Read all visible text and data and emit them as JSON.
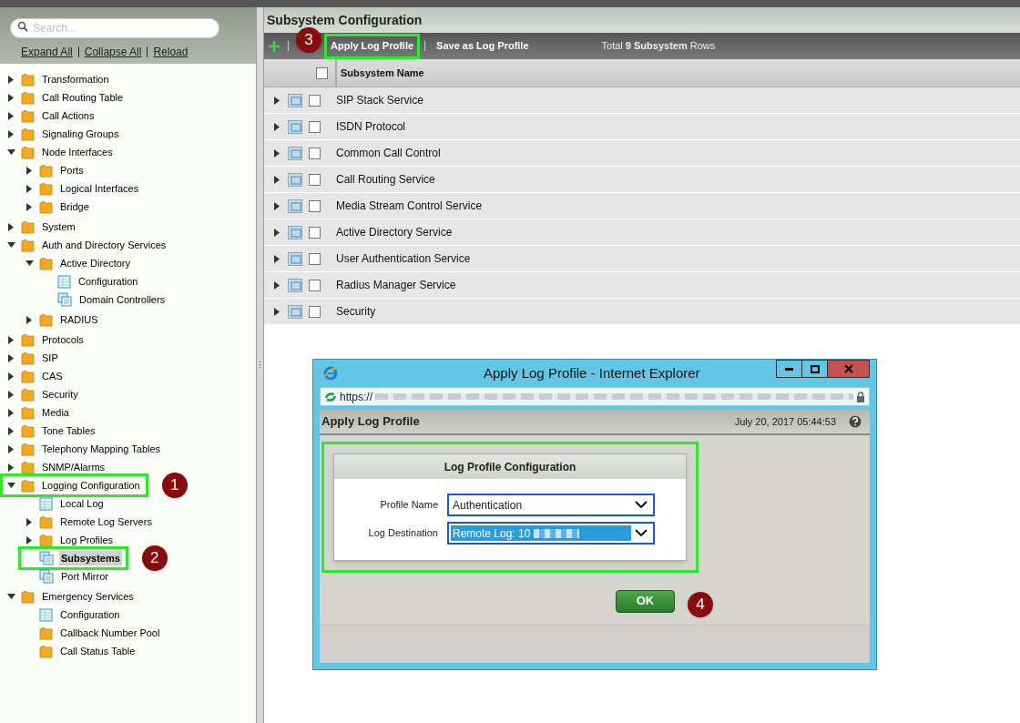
{
  "sidebar": {
    "search": {
      "placeholder": "Search..."
    },
    "links": [
      "Expand All",
      "Collapse All",
      "Reload"
    ],
    "tree": [
      {
        "label": "Transformation",
        "kind": "folder",
        "expanded": false,
        "selected": false
      },
      {
        "label": "Call Routing Table",
        "kind": "folder",
        "expanded": false,
        "selected": false
      },
      {
        "label": "Call Actions",
        "kind": "folder",
        "expanded": false,
        "selected": false
      },
      {
        "label": "Signaling Groups",
        "kind": "folder",
        "expanded": false,
        "selected": false
      },
      {
        "label": "Node Interfaces",
        "kind": "folder",
        "expanded": true,
        "selected": false,
        "children": [
          {
            "label": "Ports",
            "kind": "folder",
            "expanded": false,
            "selected": false
          },
          {
            "label": "Logical Interfaces",
            "kind": "folder",
            "expanded": false,
            "selected": false
          },
          {
            "label": "Bridge",
            "kind": "folder",
            "expanded": false,
            "selected": false
          }
        ]
      },
      {
        "label": "System",
        "kind": "folder",
        "expanded": false,
        "selected": false
      },
      {
        "label": "Auth and Directory Services",
        "kind": "folder",
        "expanded": true,
        "selected": false,
        "children": [
          {
            "label": "Active Directory",
            "kind": "folder",
            "expanded": true,
            "selected": false,
            "children": [
              {
                "label": "Configuration",
                "kind": "table",
                "selected": false
              },
              {
                "label": "Domain Controllers",
                "kind": "tables",
                "selected": false
              }
            ]
          },
          {
            "label": "RADIUS",
            "kind": "folder",
            "expanded": false,
            "selected": false
          }
        ]
      },
      {
        "label": "Protocols",
        "kind": "folder",
        "expanded": false,
        "selected": false
      },
      {
        "label": "SIP",
        "kind": "folder",
        "expanded": false,
        "selected": false
      },
      {
        "label": "CAS",
        "kind": "folder",
        "expanded": false,
        "selected": false
      },
      {
        "label": "Security",
        "kind": "folder",
        "expanded": false,
        "selected": false
      },
      {
        "label": "Media",
        "kind": "folder",
        "expanded": false,
        "selected": false
      },
      {
        "label": "Tone Tables",
        "kind": "folder",
        "expanded": false,
        "selected": false
      },
      {
        "label": "Telephony Mapping Tables",
        "kind": "folder",
        "expanded": false,
        "selected": false
      },
      {
        "label": "SNMP/Alarms",
        "kind": "folder",
        "expanded": false,
        "selected": false
      },
      {
        "label": "Logging Configuration",
        "kind": "folder",
        "expanded": true,
        "selected": false,
        "highlighted": true,
        "callout": "1",
        "children": [
          {
            "label": "Local Log",
            "kind": "table",
            "selected": false
          },
          {
            "label": "Remote Log Servers",
            "kind": "folder",
            "expanded": false,
            "selected": false
          },
          {
            "label": "Log Profiles",
            "kind": "folder",
            "expanded": false,
            "selected": false
          },
          {
            "label": "Subsystems",
            "kind": "tables",
            "selected": true,
            "highlighted": true,
            "callout": "2"
          },
          {
            "label": "Port Mirror",
            "kind": "tables",
            "selected": false
          }
        ]
      },
      {
        "label": "Emergency Services",
        "kind": "folder",
        "expanded": true,
        "selected": false,
        "children": [
          {
            "label": "Configuration",
            "kind": "table",
            "selected": false
          },
          {
            "label": "Callback Number Pool",
            "kind": "folder",
            "selected": false
          },
          {
            "label": "Call Status Table",
            "kind": "folder",
            "selected": false
          }
        ]
      }
    ]
  },
  "main": {
    "title": "Subsystem Configuration",
    "toolbar": {
      "actions": [
        {
          "label": "Apply Log Profile",
          "highlighted": true,
          "callout": "3"
        },
        {
          "label": "Save as Log Profile",
          "highlighted": false
        }
      ],
      "total": "Total **9 Subsystem** Rows"
    },
    "table": {
      "header_checked": false,
      "columns": [
        "Subsystem Name"
      ],
      "rows": [
        {
          "name": "SIP Stack Service",
          "checked": false
        },
        {
          "name": "ISDN Protocol",
          "checked": false
        },
        {
          "name": "Common Call Control",
          "checked": false
        },
        {
          "name": "Call Routing Service",
          "checked": false
        },
        {
          "name": "Media Stream Control Service",
          "checked": false
        },
        {
          "name": "Active Directory Service",
          "checked": false
        },
        {
          "name": "User Authentication Service",
          "checked": false
        },
        {
          "name": "Radius Manager Service",
          "checked": false
        },
        {
          "name": "Security",
          "checked": false
        }
      ]
    }
  },
  "dialog": {
    "title": "Apply Log Profile - Internet Explorer",
    "url": "https://",
    "page_title": "Apply Log Profile",
    "timestamp": "July 20, 2017 05:44:53",
    "panel": {
      "title": "Log Profile Configuration",
      "highlighted": true,
      "fields": [
        {
          "label": "Profile Name",
          "value": "Authentication",
          "selected": false
        },
        {
          "label": "Log Destination",
          "value": "Remote Log: 10",
          "selected": true
        }
      ]
    },
    "ok": {
      "label": "OK",
      "callout": "4"
    }
  }
}
